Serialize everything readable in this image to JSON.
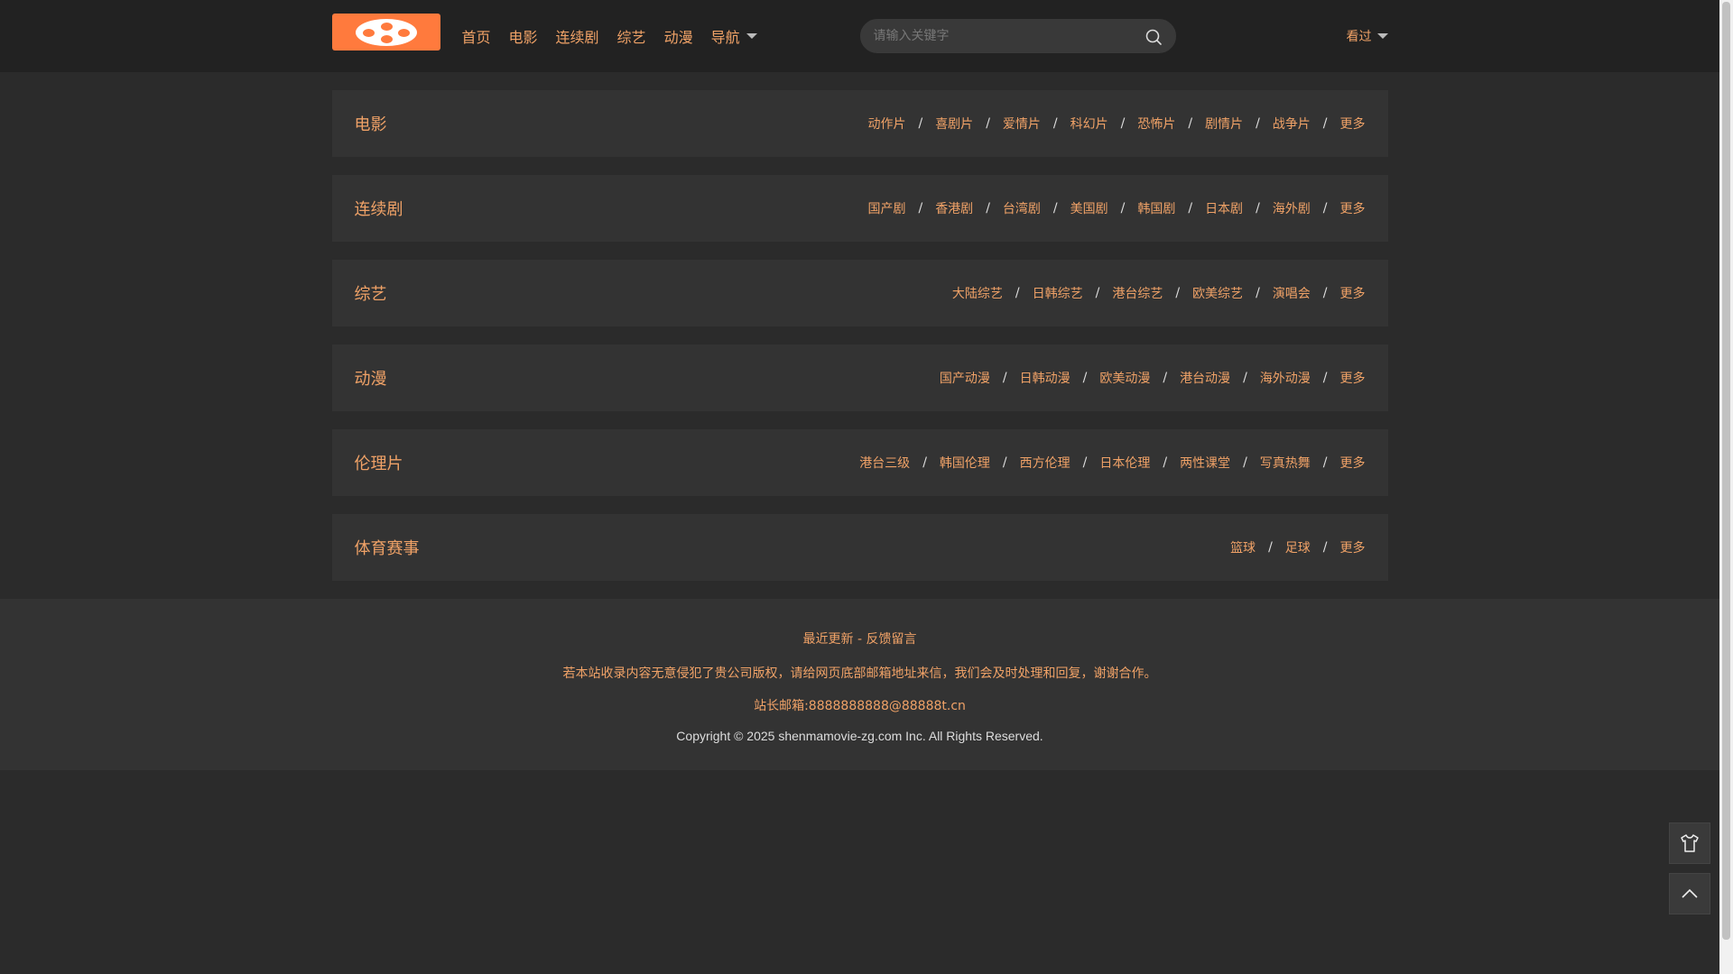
{
  "header": {
    "nav": [
      "首页",
      "电影",
      "连续剧",
      "综艺",
      "动漫",
      "导航"
    ],
    "search_placeholder": "请输入关键字",
    "history": "看过"
  },
  "categories": [
    {
      "title": "电影",
      "links": [
        "动作片",
        "喜剧片",
        "爱情片",
        "科幻片",
        "恐怖片",
        "剧情片",
        "战争片",
        "更多"
      ]
    },
    {
      "title": "连续剧",
      "links": [
        "国产剧",
        "香港剧",
        "台湾剧",
        "美国剧",
        "韩国剧",
        "日本剧",
        "海外剧",
        "更多"
      ]
    },
    {
      "title": "综艺",
      "links": [
        "大陆综艺",
        "日韩综艺",
        "港台综艺",
        "欧美综艺",
        "演唱会",
        "更多"
      ]
    },
    {
      "title": "动漫",
      "links": [
        "国产动漫",
        "日韩动漫",
        "欧美动漫",
        "港台动漫",
        "海外动漫",
        "更多"
      ]
    },
    {
      "title": "伦理片",
      "links": [
        "港台三级",
        "韩国伦理",
        "西方伦理",
        "日本伦理",
        "两性课堂",
        "写真热舞",
        "更多"
      ]
    },
    {
      "title": "体育赛事",
      "links": [
        "篮球",
        "足球",
        "更多"
      ]
    }
  ],
  "separator": "/",
  "footer": {
    "recent": "最近更新",
    "dash": " - ",
    "feedback": "反馈留言",
    "notice": "若本站收录内容无意侵犯了贵公司版权，请给网页底部邮箱地址来信，我们会及时处理和回复，谢谢合作。",
    "email": "站长邮箱:8888888888@88888t.cn",
    "copyright": "Copyright © 2025 shenmamovie-zg.com Inc. All Rights Reserved."
  },
  "icons": {
    "theme": "shirt-icon",
    "top": "chevron-up-icon"
  },
  "colors": {
    "accent": "#f0a267",
    "logo": "#ff7a3d",
    "background": "#2b2b2b",
    "panel": "#333333"
  }
}
